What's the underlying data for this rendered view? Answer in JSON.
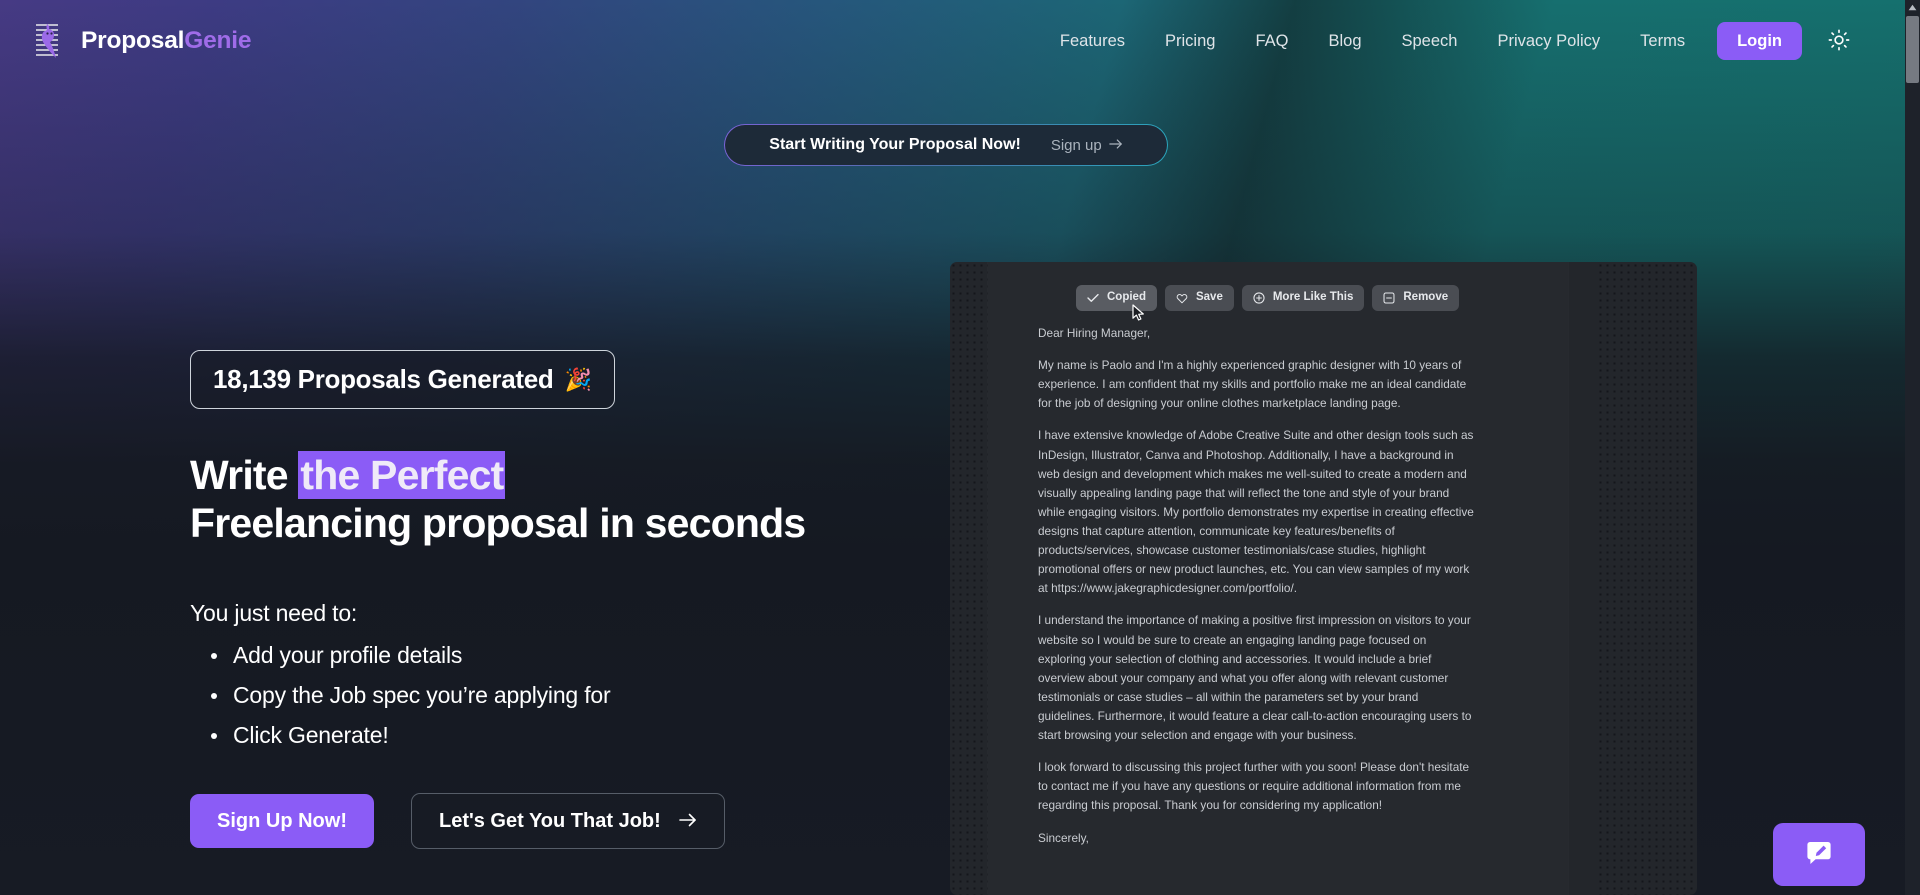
{
  "brand": {
    "name_first": "Proposal",
    "name_second": "Genie",
    "logo_icon": "genie-lamp-icon"
  },
  "header": {
    "nav": [
      {
        "label": "Features"
      },
      {
        "label": "Pricing"
      },
      {
        "label": "FAQ"
      },
      {
        "label": "Blog"
      },
      {
        "label": "Speech"
      },
      {
        "label": "Privacy Policy"
      },
      {
        "label": "Terms"
      }
    ],
    "login_label": "Login",
    "theme_toggle_icon": "sun-icon",
    "accent_color": "#8b5cf6"
  },
  "announcement": {
    "title": "Start Writing Your Proposal Now!",
    "cta_label": "Sign up",
    "cta_icon": "arrow-right-icon"
  },
  "hero": {
    "stat_badge": {
      "text": "18,139 Proposals Generated",
      "emoji": "🎉"
    },
    "headline_line1_plain": "Write ",
    "headline_line1_highlight": "the Perfect",
    "headline_line2": "Freelancing proposal in seconds",
    "highlight_color": "#8b5cf6",
    "needs_title": "You just need to:",
    "needs_items": [
      "Add your profile details",
      "Copy the Job spec you’re applying for",
      "Click Generate!"
    ],
    "primary_cta": "Sign Up Now!",
    "secondary_cta": "Let's Get You That Job!",
    "secondary_cta_icon": "arrow-right-icon"
  },
  "preview": {
    "toolbar": [
      {
        "label": "Copied",
        "icon": "check-icon",
        "state": "active"
      },
      {
        "label": "Save",
        "icon": "heart-icon",
        "state": "default"
      },
      {
        "label": "More Like This",
        "icon": "plus-circle-icon",
        "state": "default"
      },
      {
        "label": "Remove",
        "icon": "minus-square-icon",
        "state": "default"
      }
    ],
    "proposal_paragraphs": [
      "Dear Hiring Manager,",
      "My name is Paolo and I'm a highly experienced graphic designer with 10 years of experience. I am confident that my skills and portfolio make me an ideal candidate for the job of designing your online clothes marketplace landing page.",
      "I have extensive knowledge of Adobe Creative Suite and other design tools such as InDesign, Illustrator, Canva and Photoshop. Additionally, I have a background in web design and development which makes me well-suited to create a modern and visually appealing landing page that will reflect the tone and style of your brand while engaging visitors. My portfolio demonstrates my expertise in creating effective designs that capture attention, communicate key features/benefits of products/services, showcase customer testimonials/case studies, highlight promotional offers or new product launches, etc. You can view samples of my work at https://www.jakegraphicdesigner.com/portfolio/.",
      "I understand the importance of making a positive first impression on visitors to your website so I would be sure to create an engaging landing page focused on exploring your selection of clothing and accessories. It would include a brief overview about your company and what you offer along with relevant customer testimonials or case studies – all within the parameters set by your brand guidelines. Furthermore, it would feature a clear call-to-action encouraging users to start browsing your selection and engage with your business.",
      "I look forward to discussing this project further with you soon! Please don't hesitate to contact me if you have any questions or require additional information from me regarding this proposal. Thank you for considering my application!",
      "Sincerely,"
    ]
  },
  "chat_widget": {
    "icon": "chat-compose-icon",
    "color": "#8b5cf6"
  },
  "scrollbar": {
    "up_arrow_icon": "chevron-up-icon"
  }
}
